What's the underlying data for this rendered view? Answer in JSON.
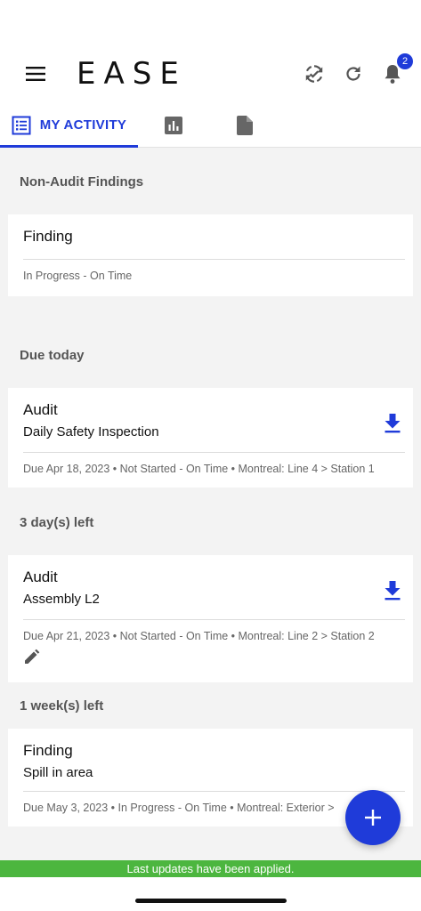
{
  "app": {
    "logo_text": "EASE",
    "notification_count": "2"
  },
  "tabs": [
    {
      "label": "MY ACTIVITY",
      "icon": "list-icon",
      "active": true
    },
    {
      "label": "",
      "icon": "bar-chart-icon",
      "active": false
    },
    {
      "label": "",
      "icon": "document-icon",
      "active": false
    }
  ],
  "sections": [
    {
      "title": "Non-Audit Findings",
      "cards": [
        {
          "type": "Finding",
          "name": "",
          "meta": "In Progress - On Time",
          "download": false,
          "editable": false
        }
      ]
    },
    {
      "title": "Due today",
      "cards": [
        {
          "type": "Audit",
          "name": "Daily Safety Inspection",
          "meta": "Due Apr 18, 2023 • Not Started - On Time • Montreal: Line 4 > Station 1",
          "download": true,
          "editable": false
        }
      ]
    },
    {
      "title": "3 day(s) left",
      "cards": [
        {
          "type": "Audit",
          "name": "Assembly L2",
          "meta": "Due Apr 21, 2023 • Not Started - On Time • Montreal: Line 2 > Station 2",
          "download": true,
          "editable": true
        }
      ]
    },
    {
      "title": "1 week(s) left",
      "cards": [
        {
          "type": "Finding",
          "name": "Spill in area",
          "meta": "Due May 3, 2023 • In Progress - On Time • Montreal: Exterior > ",
          "download": false,
          "editable": false
        }
      ]
    }
  ],
  "fab": {
    "label": "+"
  },
  "snackbar": {
    "message": "Last updates have been applied."
  },
  "colors": {
    "accent": "#1f3bd9",
    "snackbar": "#4cb63f",
    "background": "#f3f3f3"
  }
}
